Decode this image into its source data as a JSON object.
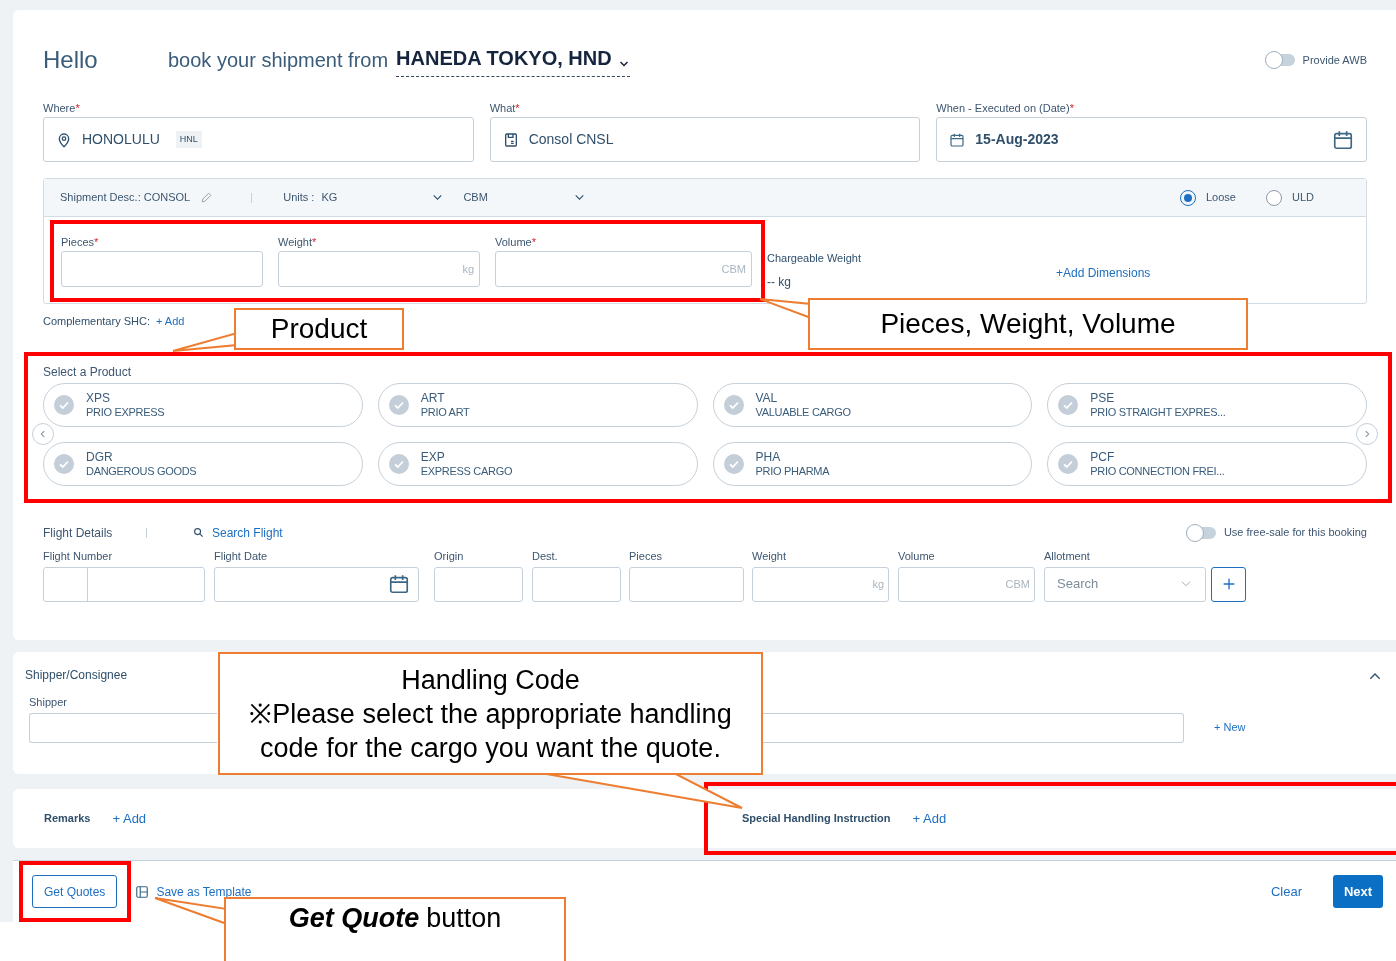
{
  "header": {
    "greeting": "Hello",
    "prompt": "book your shipment from",
    "origin": "HANEDA TOKYO, HND",
    "awb_toggle": {
      "label": "Provide AWB",
      "on": false
    }
  },
  "fields": [
    {
      "kind": "location",
      "label": "Where",
      "mark": "*",
      "value": "HONOLULU",
      "code": "HNL"
    },
    {
      "kind": "commodity",
      "label": "What",
      "mark": "*",
      "value": "Consol CNSL"
    },
    {
      "kind": "date",
      "label": "When - Executed on (Date)",
      "mark": "*",
      "value": "15-Aug-2023"
    }
  ],
  "shipment": {
    "description": "Shipment Desc.: CONSOL",
    "units_label": "Units :",
    "weight_unit": "KG",
    "volume_unit": "CBM",
    "packing": [
      {
        "label": "Loose",
        "selected": true
      },
      {
        "label": "ULD",
        "selected": false
      }
    ],
    "measures": [
      {
        "label": "Pieces",
        "mark": "*"
      },
      {
        "label": "Weight",
        "mark": "*",
        "unit": "kg"
      },
      {
        "label": "Volume",
        "mark": "*",
        "unit": "CBM"
      }
    ],
    "chargeable_weight": {
      "label": "Chargeable Weight",
      "value": "-- kg"
    },
    "add_dimensions": "+Add Dimensions"
  },
  "complementary_shc": {
    "label": "Complementary SHC:",
    "action": "+ Add"
  },
  "products": {
    "title": "Select a Product",
    "items": [
      {
        "code": "XPS",
        "name": "PRIO EXPRESS",
        "selected": false
      },
      {
        "code": "ART",
        "name": "PRIO ART",
        "selected": false
      },
      {
        "code": "VAL",
        "name": "VALUABLE CARGO",
        "selected": false
      },
      {
        "code": "PSE",
        "name": "PRIO STRAIGHT EXPRES...",
        "selected": false
      },
      {
        "code": "DGR",
        "name": "DANGEROUS GOODS",
        "selected": false
      },
      {
        "code": "EXP",
        "name": "EXPRESS CARGO",
        "selected": false
      },
      {
        "code": "PHA",
        "name": "PRIO PHARMA",
        "selected": false
      },
      {
        "code": "PCF",
        "name": "PRIO CONNECTION FREI...",
        "selected": false
      }
    ]
  },
  "flight_details": {
    "title": "Flight Details",
    "search": "Search Flight",
    "free_sale_toggle": {
      "label": "Use free-sale for this booking",
      "on": false
    },
    "columns": [
      {
        "kind": "split",
        "label": "Flight Number"
      },
      {
        "kind": "date",
        "label": "Flight Date"
      },
      {
        "kind": "text",
        "label": "Origin"
      },
      {
        "kind": "text",
        "label": "Dest."
      },
      {
        "kind": "text",
        "label": "Pieces"
      },
      {
        "kind": "unit",
        "label": "Weight",
        "unit": "kg"
      },
      {
        "kind": "unit",
        "label": "Volume",
        "unit": "CBM"
      },
      {
        "kind": "select",
        "label": "Allotment",
        "placeholder": "Search"
      }
    ]
  },
  "shipper_consignee": {
    "title": "Shipper/Consignee",
    "expanded": true,
    "shipper_label": "Shipper",
    "new_action": "+ New"
  },
  "remarks": {
    "label": "Remarks",
    "action": "+ Add"
  },
  "special_handling": {
    "label": "Special Handling Instruction",
    "action": "+ Add"
  },
  "footer": {
    "get_quotes": "Get Quotes",
    "save_template": "Save as Template",
    "clear": "Clear",
    "next": "Next"
  },
  "annotations": [
    {
      "kind": "callout",
      "text": "Product"
    },
    {
      "kind": "callout",
      "text": "Pieces, Weight, Volume"
    },
    {
      "kind": "callout",
      "text": "Handling Code\n※Please select the appropriate handling\ncode for the cargo you want the quote."
    },
    {
      "kind": "callout",
      "text": "**Get Quote** button"
    }
  ]
}
